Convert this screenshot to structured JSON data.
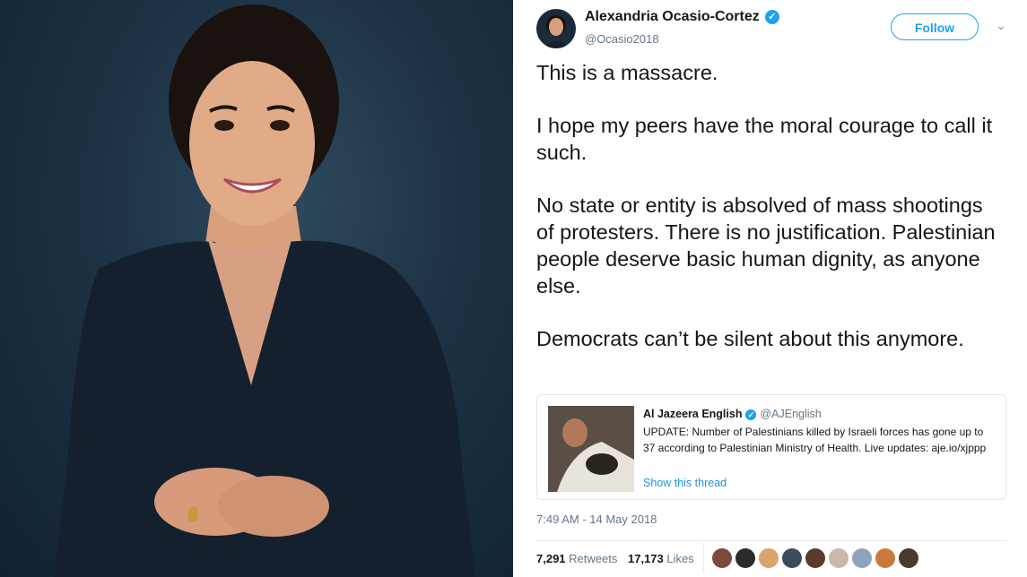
{
  "tweet": {
    "author_name": "Alexandria Ocasio-Cortez",
    "author_handle": "@Ocasio2018",
    "verified_glyph": "✓",
    "follow_label": "Follow",
    "menu_glyph": "⌄",
    "paragraphs": [
      "This is a massacre.",
      "I hope my peers have the moral courage to call it such.",
      "No state or entity is absolved of mass shootings of protesters. There is no justification. Palestinian people deserve basic human dignity, as anyone else.",
      "Democrats can’t be silent about this anymore."
    ],
    "timestamp": "7:49 AM - 14 May 2018",
    "retweets_count": "7,291",
    "retweets_label": "Retweets",
    "likes_count": "17,173",
    "likes_label": "Likes"
  },
  "quoted_tweet": {
    "author_name": "Al Jazeera English",
    "author_handle": "@AJEnglish",
    "text": "UPDATE: Number of Palestinians killed by Israeli forces has gone up to 37 according to Palestinian Ministry of Health. Live updates: aje.io/xjppp",
    "show_thread": "Show this thread"
  },
  "colors": {
    "accent": "#1da1f2",
    "link": "#1b95e0",
    "text": "#14171a",
    "muted": "#657786"
  },
  "likers": [
    "#7a4b3a",
    "#2b2b2b",
    "#d9a36a",
    "#3a4d5c",
    "#5a3a2a",
    "#c9b8a8",
    "#8fa3b8",
    "#c97a3a",
    "#4a3a2a"
  ]
}
